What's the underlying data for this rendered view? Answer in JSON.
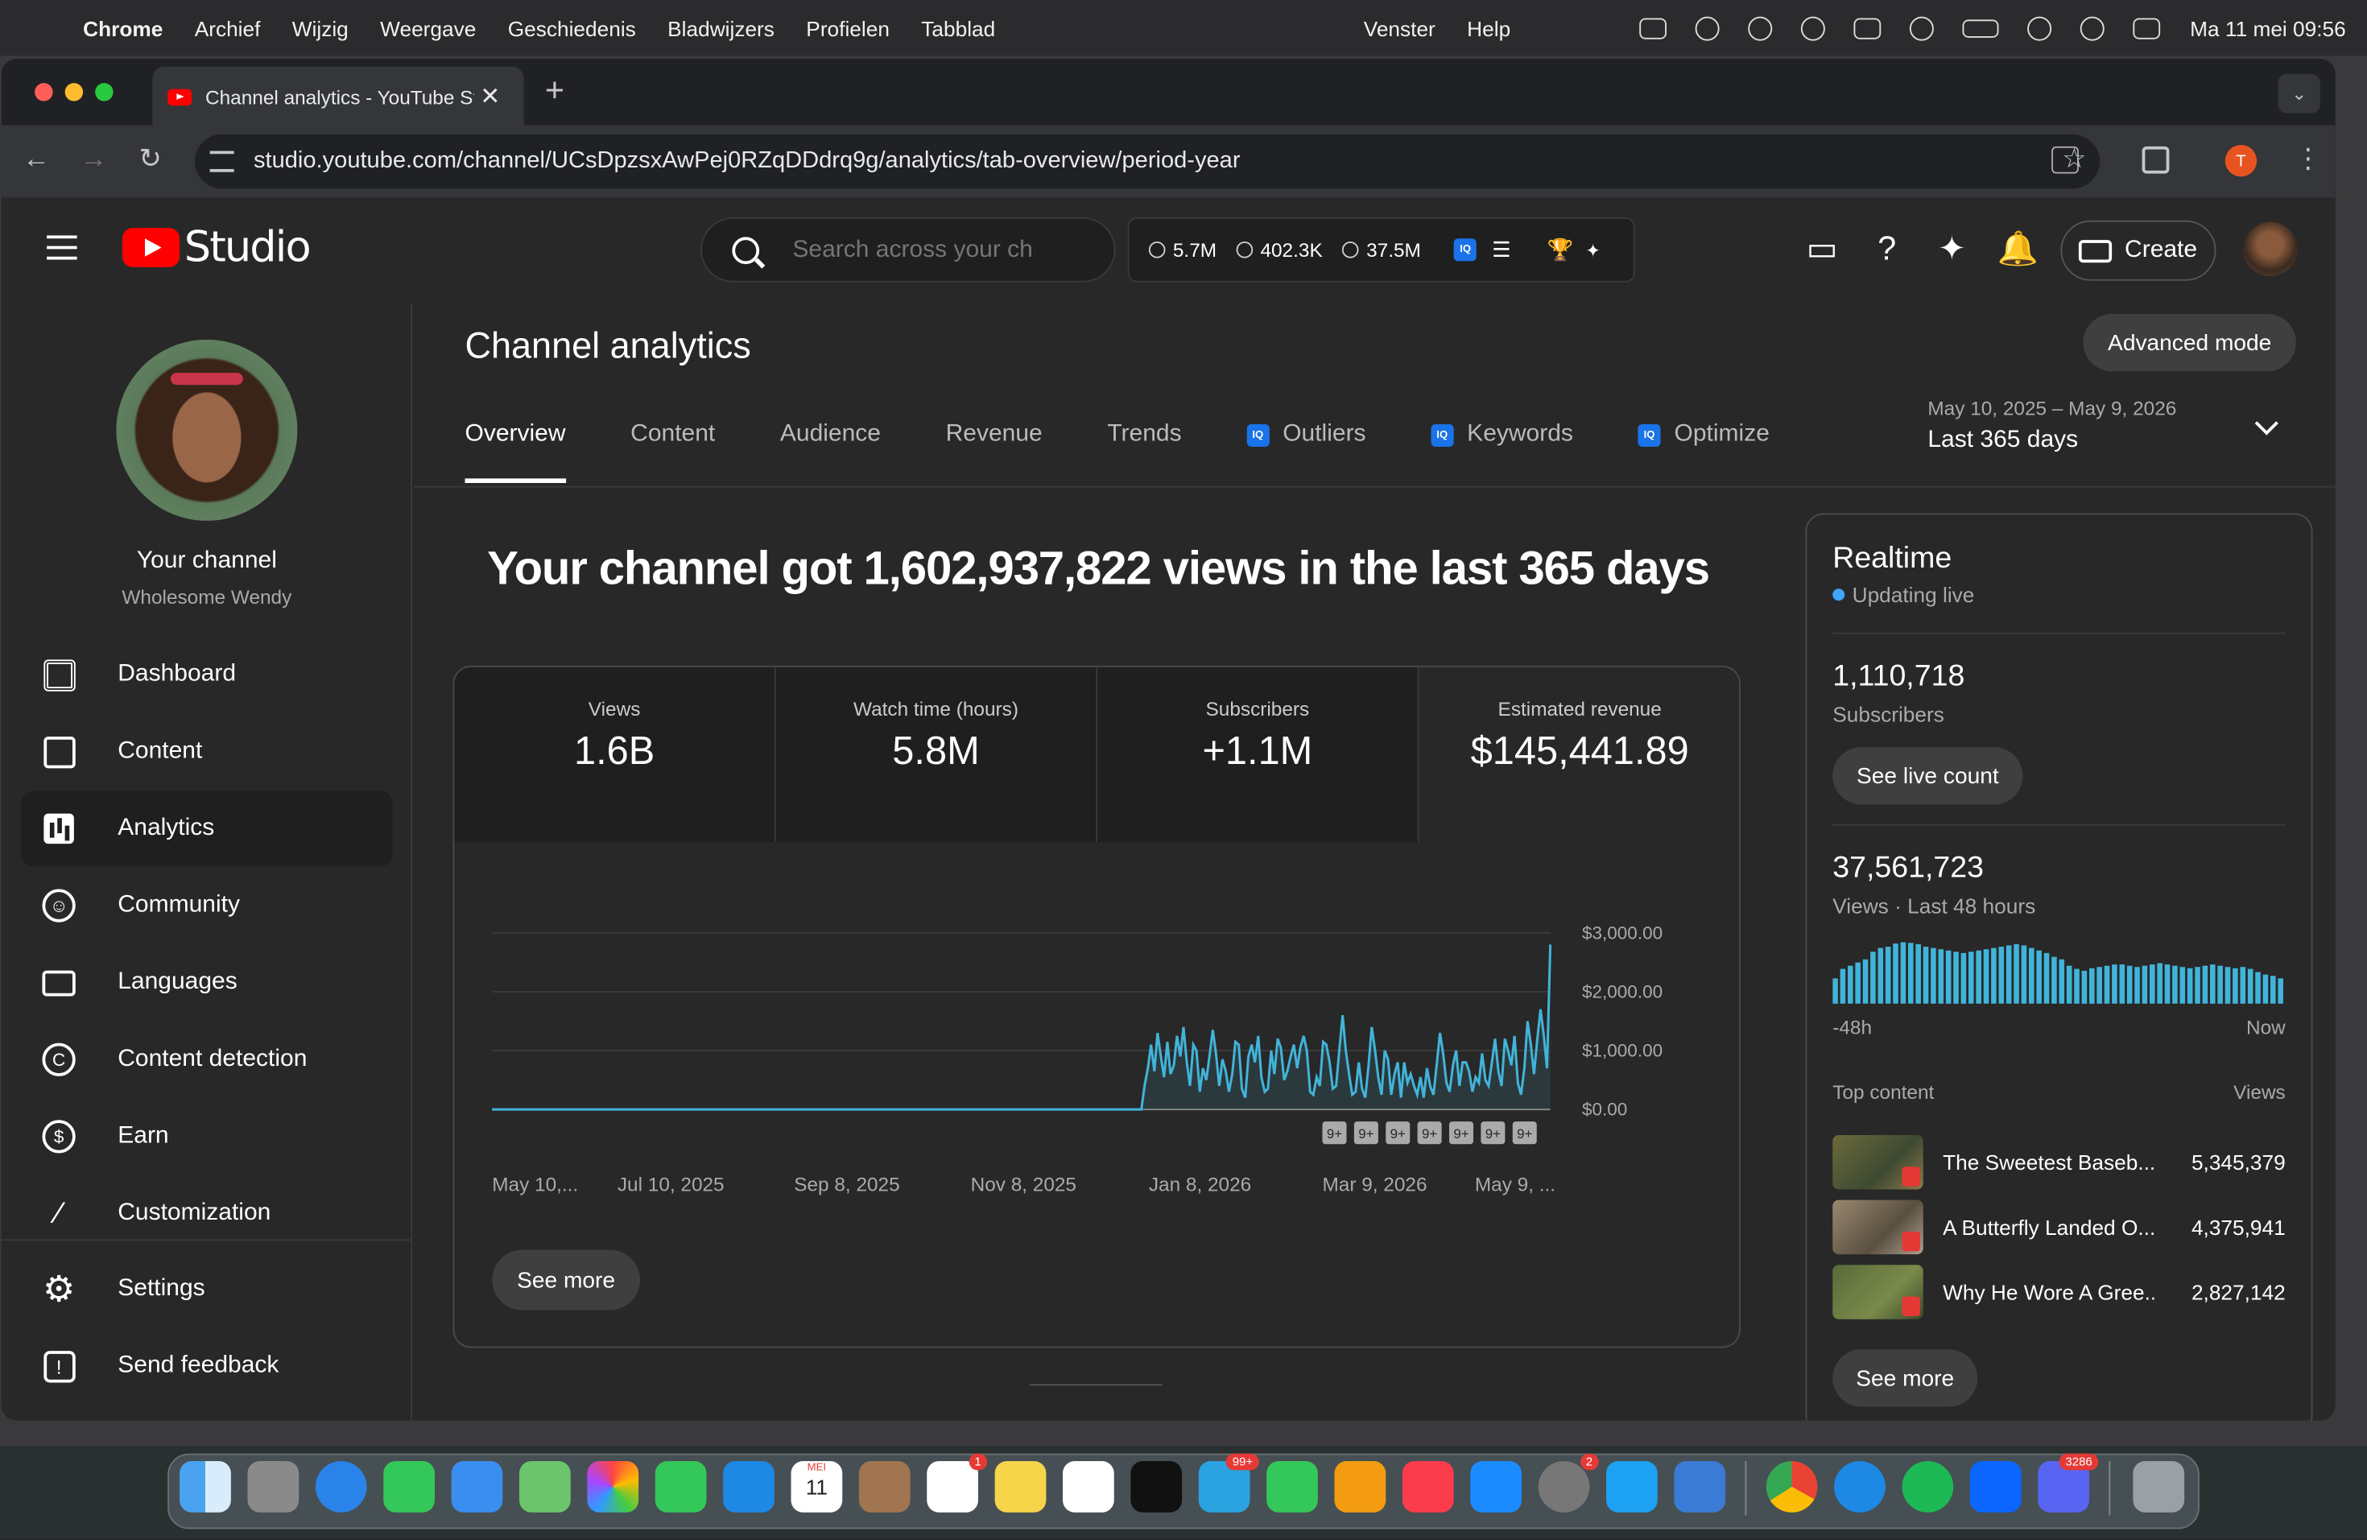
{
  "menubar": {
    "app": "Chrome",
    "items": [
      "Archief",
      "Wijzig",
      "Weergave",
      "Geschiedenis",
      "Bladwijzers",
      "Profielen",
      "Tabblad"
    ],
    "right_items": [
      "Venster",
      "Help"
    ],
    "clock": "Ma 11 mei  09:56"
  },
  "browser": {
    "tab_title": "Channel analytics - YouTube Studio",
    "url": "studio.youtube.com/channel/UCsDpzsxAwPej0RZqDDdrq9g/analytics/tab-overview/period-year",
    "profile_initial": "T"
  },
  "header": {
    "brand": "Studio",
    "search_placeholder": "Search across your channel",
    "stats": {
      "watch": "5.7M",
      "views_a": "402.3K",
      "views_b": "37.5M"
    },
    "create_label": "Create"
  },
  "sidebar": {
    "channel_name": "Your channel",
    "channel_handle": "Wholesome Wendy",
    "items": [
      {
        "label": "Dashboard",
        "icon": "dashboard-icon"
      },
      {
        "label": "Content",
        "icon": "content-icon"
      },
      {
        "label": "Analytics",
        "icon": "analytics-icon",
        "active": true
      },
      {
        "label": "Community",
        "icon": "community-icon"
      },
      {
        "label": "Languages",
        "icon": "languages-icon"
      },
      {
        "label": "Content detection",
        "icon": "copyright-icon"
      },
      {
        "label": "Earn",
        "icon": "dollar-icon"
      },
      {
        "label": "Customization",
        "icon": "magic-wand-icon"
      },
      {
        "label": "Settings",
        "icon": "gear-icon"
      },
      {
        "label": "Send feedback",
        "icon": "feedback-icon"
      }
    ]
  },
  "main": {
    "title": "Channel analytics",
    "advanced_mode": "Advanced mode",
    "tabs": [
      "Overview",
      "Content",
      "Audience",
      "Revenue",
      "Trends",
      "Outliers",
      "Keywords",
      "Optimize"
    ],
    "date_range": "May 10, 2025 – May 9, 2026",
    "date_label": "Last 365 days",
    "headline": "Your channel got 1,602,937,822 views in the last 365 days",
    "metrics": [
      {
        "label": "Views",
        "value": "1.6B"
      },
      {
        "label": "Watch time (hours)",
        "value": "5.8M"
      },
      {
        "label": "Subscribers",
        "value": "+1.1M"
      },
      {
        "label": "Estimated revenue",
        "value": "$145,441.89"
      }
    ],
    "see_more": "See more"
  },
  "chart_data": {
    "type": "area",
    "title": "",
    "xlabel": "",
    "ylabel": "",
    "ylim": [
      0,
      3000
    ],
    "y_ticks": [
      "$3,000.00",
      "$2,000.00",
      "$1,000.00",
      "$0.00"
    ],
    "x_ticks": [
      "May 10,...",
      "Jul 10, 2025",
      "Sep 8, 2025",
      "Nov 8, 2025",
      "Jan 8, 2026",
      "Mar 9, 2026",
      "May 9, ..."
    ],
    "markers": [
      "9+",
      "9+",
      "9+",
      "9+",
      "9+",
      "9+",
      "9+"
    ],
    "series": [
      {
        "color": "#41b4d9",
        "values": [
          0,
          0,
          0,
          0,
          0,
          0,
          0,
          0,
          0,
          0,
          0,
          0,
          0,
          0,
          0,
          0,
          0,
          0,
          0,
          0,
          0,
          0,
          0,
          0,
          0,
          0,
          0,
          0,
          0,
          0,
          0,
          0,
          0,
          0,
          0,
          0,
          0,
          0,
          0,
          0,
          0,
          0,
          0,
          0,
          0,
          0,
          0,
          0,
          0,
          0,
          0,
          0,
          0,
          0,
          0,
          0,
          0,
          0,
          0,
          0,
          0,
          0,
          0,
          0,
          0,
          0,
          0,
          0,
          0,
          0,
          0,
          0,
          0,
          0,
          0,
          0,
          0,
          0,
          0,
          0,
          0,
          0,
          0,
          0,
          0,
          0,
          0,
          0,
          0,
          0,
          0,
          0,
          0,
          0,
          0,
          0,
          0,
          0,
          0,
          0,
          0,
          0,
          0,
          0,
          0,
          0,
          0,
          0,
          0,
          0,
          0,
          0,
          0,
          0,
          0,
          0,
          0,
          0,
          0,
          0,
          0,
          0,
          0,
          0,
          0,
          0,
          0,
          0,
          0,
          0,
          0,
          0,
          0,
          0,
          0,
          0,
          0,
          0,
          0,
          0,
          0,
          0,
          0,
          0,
          0,
          0,
          0,
          0,
          0,
          0,
          0,
          0,
          0,
          0,
          0,
          0,
          0,
          0,
          0,
          0,
          0,
          0,
          0,
          0,
          0,
          0,
          0,
          0,
          0,
          0,
          0,
          0,
          0,
          0,
          0,
          0,
          0,
          0,
          0,
          0,
          0,
          0,
          0,
          0,
          0,
          0,
          0,
          0,
          0,
          0,
          0,
          0,
          0,
          0,
          0,
          0,
          0,
          0,
          0,
          0,
          0,
          400,
          700,
          1100,
          650,
          1300,
          900,
          550,
          1150,
          600,
          750,
          1250,
          900,
          1400,
          800,
          400,
          1100,
          1000,
          300,
          700,
          500,
          900,
          1350,
          950,
          400,
          850,
          650,
          300,
          600,
          1150,
          1100,
          350,
          200,
          900,
          1100,
          800,
          1250,
          550,
          300,
          350,
          1000,
          600,
          1200,
          1050,
          500,
          650,
          900,
          1100,
          700,
          1050,
          1250,
          1000,
          300,
          250,
          550,
          400,
          1150,
          1100,
          800,
          350,
          400,
          1000,
          1600,
          1000,
          600,
          250,
          300,
          800,
          350,
          200,
          750,
          1400,
          1000,
          550,
          250,
          1000,
          850,
          250,
          600,
          800,
          200,
          800,
          450,
          600,
          400,
          250,
          550,
          200,
          700,
          400,
          250,
          750,
          1300,
          950,
          450,
          300,
          750,
          1000,
          400,
          800,
          800,
          650,
          300,
          550,
          450,
          950,
          500,
          400,
          800,
          1200,
          650,
          400,
          1200,
          1000,
          750,
          1250,
          450,
          250,
          700,
          1500,
          1100,
          600,
          1200,
          1700,
          1250,
          700,
          2800
        ]
      }
    ]
  },
  "realtime": {
    "title": "Realtime",
    "status": "Updating live",
    "subscribers_value": "1,110,718",
    "subscribers_label": "Subscribers",
    "see_live_count": "See live count",
    "views_value": "37,561,723",
    "views_label": "Views · Last 48 hours",
    "axis_start": "-48h",
    "axis_end": "Now",
    "bars": [
      40,
      55,
      60,
      65,
      70,
      82,
      88,
      90,
      95,
      97,
      96,
      94,
      90,
      88,
      86,
      84,
      82,
      80,
      82,
      84,
      86,
      88,
      90,
      92,
      94,
      92,
      88,
      84,
      80,
      74,
      70,
      60,
      55,
      52,
      56,
      58,
      60,
      62,
      62,
      60,
      58,
      60,
      62,
      64,
      62,
      60,
      58,
      56,
      58,
      60,
      62,
      60,
      58,
      56,
      58,
      55,
      50,
      46,
      44,
      40
    ],
    "bar_color": "#41b4d9",
    "top_content_label": "Top content",
    "top_content_views": "Views",
    "top_content": [
      {
        "title": "The Sweetest Baseb...",
        "views": "5,345,379"
      },
      {
        "title": "A Butterfly Landed O...",
        "views": "4,375,941"
      },
      {
        "title": "Why He Wore A Gree...",
        "views": "2,827,142"
      }
    ],
    "see_more": "See more"
  },
  "dock": {
    "calendar_month": "MEI",
    "calendar_day": "11",
    "badges": [
      "1",
      "99+",
      "2",
      "3286"
    ]
  }
}
